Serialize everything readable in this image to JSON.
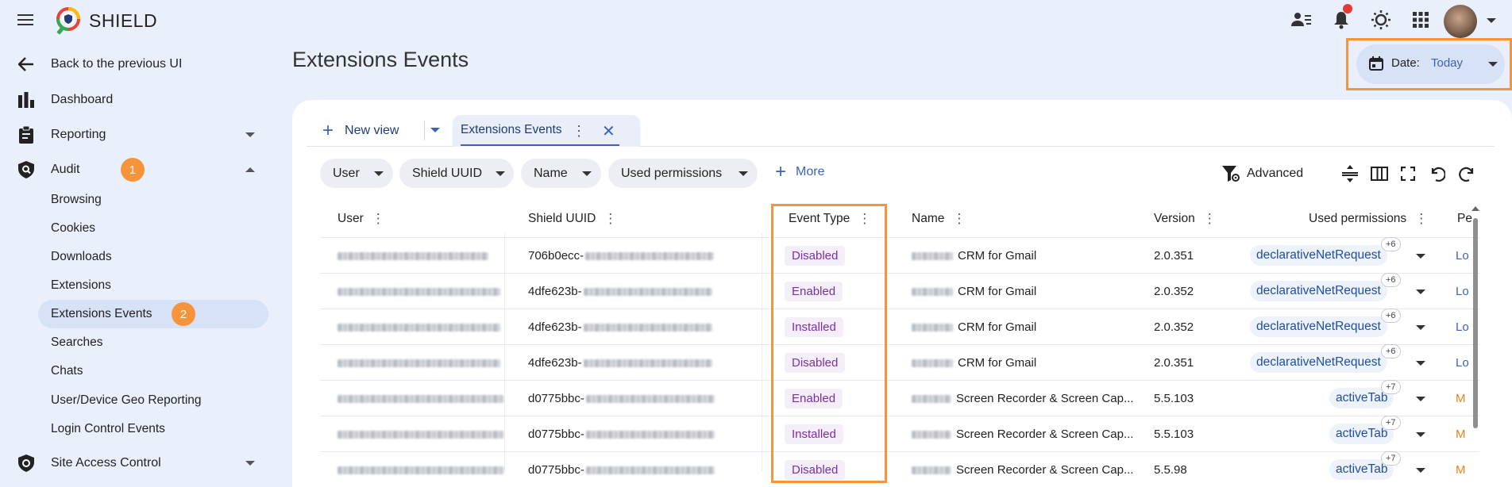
{
  "brand": {
    "name": "SHIELD"
  },
  "topbar": {
    "icons": [
      "contacts-icon",
      "bell-icon",
      "brightness-icon",
      "apps-grid-icon"
    ]
  },
  "sidebar": {
    "back_label": "Back to the previous UI",
    "items": [
      {
        "label": "Dashboard",
        "icon": "bar-chart-icon"
      },
      {
        "label": "Reporting",
        "icon": "clipboard-icon"
      },
      {
        "label": "Audit",
        "icon": "shield-search-icon",
        "badge": "1"
      },
      {
        "label": "Site Access Control",
        "icon": "shield-check-icon"
      }
    ],
    "audit_children": [
      {
        "label": "Browsing"
      },
      {
        "label": "Cookies"
      },
      {
        "label": "Downloads"
      },
      {
        "label": "Extensions"
      },
      {
        "label": "Extensions Events",
        "badge": "2"
      },
      {
        "label": "Searches"
      },
      {
        "label": "Chats"
      },
      {
        "label": "User/Device Geo Reporting"
      },
      {
        "label": "Login Control Events"
      }
    ]
  },
  "main": {
    "title": "Extensions Events",
    "date": {
      "label": "Date:",
      "value": "Today"
    },
    "tabs": {
      "new_view": "New view",
      "active_tab": "Extensions Events"
    },
    "filters": [
      "User",
      "Shield UUID",
      "Name",
      "Used permissions"
    ],
    "more_label": "More",
    "advanced_label": "Advanced"
  },
  "table": {
    "columns": [
      "User",
      "Shield UUID",
      "Event Type",
      "Name",
      "Version",
      "Used permissions",
      "Pe"
    ],
    "rows": [
      {
        "uuid": "706b0ecc-",
        "event": "Disabled",
        "name": "CRM for Gmail",
        "version": "2.0.351",
        "perm": "declarativeNetRequest",
        "extra": "+6",
        "trunc": "Lo"
      },
      {
        "uuid": "4dfe623b-",
        "event": "Enabled",
        "name": "CRM for Gmail",
        "version": "2.0.352",
        "perm": "declarativeNetRequest",
        "extra": "+6",
        "trunc": "Lo"
      },
      {
        "uuid": "4dfe623b-",
        "event": "Installed",
        "name": "CRM for Gmail",
        "version": "2.0.352",
        "perm": "declarativeNetRequest",
        "extra": "+6",
        "trunc": "Lo"
      },
      {
        "uuid": "4dfe623b-",
        "event": "Disabled",
        "name": "CRM for Gmail",
        "version": "2.0.351",
        "perm": "declarativeNetRequest",
        "extra": "+6",
        "trunc": "Lo"
      },
      {
        "uuid": "d0775bbc-",
        "event": "Enabled",
        "name": "Screen Recorder & Screen Cap...",
        "version": "5.5.103",
        "perm": "activeTab",
        "extra": "+7",
        "trunc": "M"
      },
      {
        "uuid": "d0775bbc-",
        "event": "Installed",
        "name": "Screen Recorder & Screen Cap...",
        "version": "5.5.103",
        "perm": "activeTab",
        "extra": "+7",
        "trunc": "M"
      },
      {
        "uuid": "d0775bbc-",
        "event": "Disabled",
        "name": "Screen Recorder & Screen Cap...",
        "version": "5.5.98",
        "perm": "activeTab",
        "extra": "+7",
        "trunc": "M"
      }
    ]
  },
  "colors": {
    "accent": "#3c63b8",
    "highlight": "#f7943b",
    "event_text": "#7c2fa0",
    "background": "#eaf0fb"
  }
}
